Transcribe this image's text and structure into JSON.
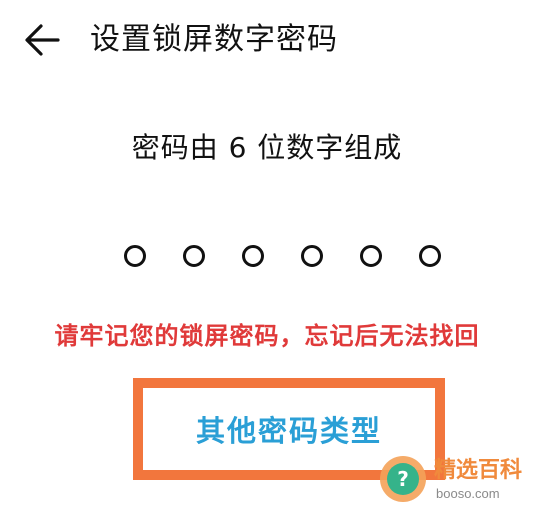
{
  "header": {
    "back_icon": "arrow-left-icon",
    "title": "设置锁屏数字密码"
  },
  "prompt": {
    "subtitle": "密码由 6 位数字组成"
  },
  "pin": {
    "length": 6,
    "filled": 0
  },
  "warning": {
    "text": "请牢记您的锁屏密码，忘记后无法找回",
    "color": "#e03a3a"
  },
  "actions": {
    "other_types_label": "其他密码类型",
    "label_color": "#2a9fd6",
    "highlight_color": "#f2763d"
  },
  "watermark": {
    "title": "精选百科",
    "url": "booso.com",
    "icon": "question-mark-icon"
  }
}
